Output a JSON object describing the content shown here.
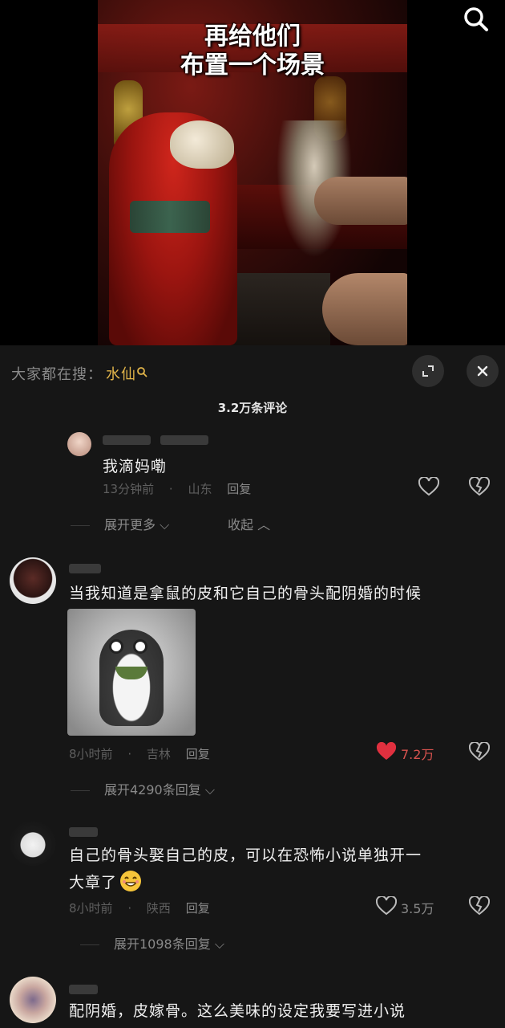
{
  "video": {
    "caption_line1": "再给他们",
    "caption_line2": "布置一个场景"
  },
  "hot_search": {
    "prefix": "大家都在搜：",
    "keyword": "水仙"
  },
  "comments_header": {
    "count_label": "3.2万条评论"
  },
  "reply_block": {
    "text": "我滴妈嘞",
    "time": "13分钟前",
    "location": "山东",
    "reply_label": "回复",
    "expand_more": "展开更多",
    "collapse": "收起"
  },
  "comments": [
    {
      "text": "当我知道是拿鼠的皮和它自己的骨头配阴婚的时候",
      "time": "8小时前",
      "location": "吉林",
      "reply_label": "回复",
      "likes": "7.2万",
      "liked": true,
      "expand_replies": "展开4290条回复"
    },
    {
      "text_line1": "自己的骨头娶自己的皮，可以在恐怖小说单独开一",
      "text_line2": "大章了",
      "time": "8小时前",
      "location": "陕西",
      "reply_label": "回复",
      "likes": "3.5万",
      "liked": false,
      "expand_replies": "展开1098条回复"
    },
    {
      "text": "配阴婚，皮嫁骨。这么美味的设定我要写进小说"
    }
  ],
  "colors": {
    "background": "#161616",
    "keyword": "#e2b54a",
    "like_active": "#e0303f",
    "muted": "#8a8a8a"
  }
}
